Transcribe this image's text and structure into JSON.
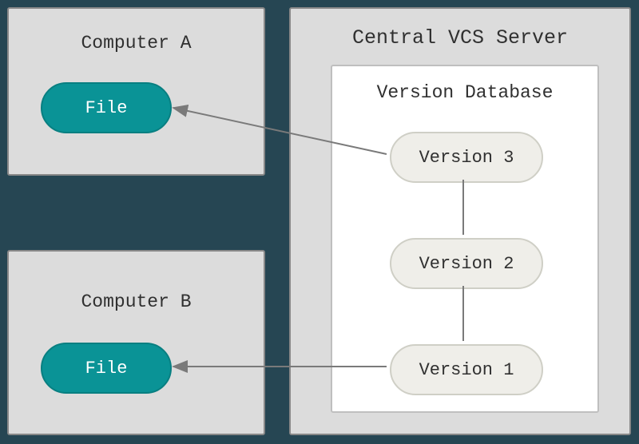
{
  "computers": {
    "a": {
      "title": "Computer A",
      "file_label": "File"
    },
    "b": {
      "title": "Computer B",
      "file_label": "File"
    }
  },
  "server": {
    "title": "Central VCS Server",
    "database": {
      "title": "Version Database",
      "versions": [
        "Version 3",
        "Version 2",
        "Version 1"
      ]
    }
  },
  "colors": {
    "background": "#264653",
    "panel": "#dcdcdc",
    "panel_border": "#888888",
    "teal": "#0a9396",
    "version_pill": "#efeee9",
    "db_bg": "#ffffff",
    "arrow": "#7a7a7a"
  }
}
